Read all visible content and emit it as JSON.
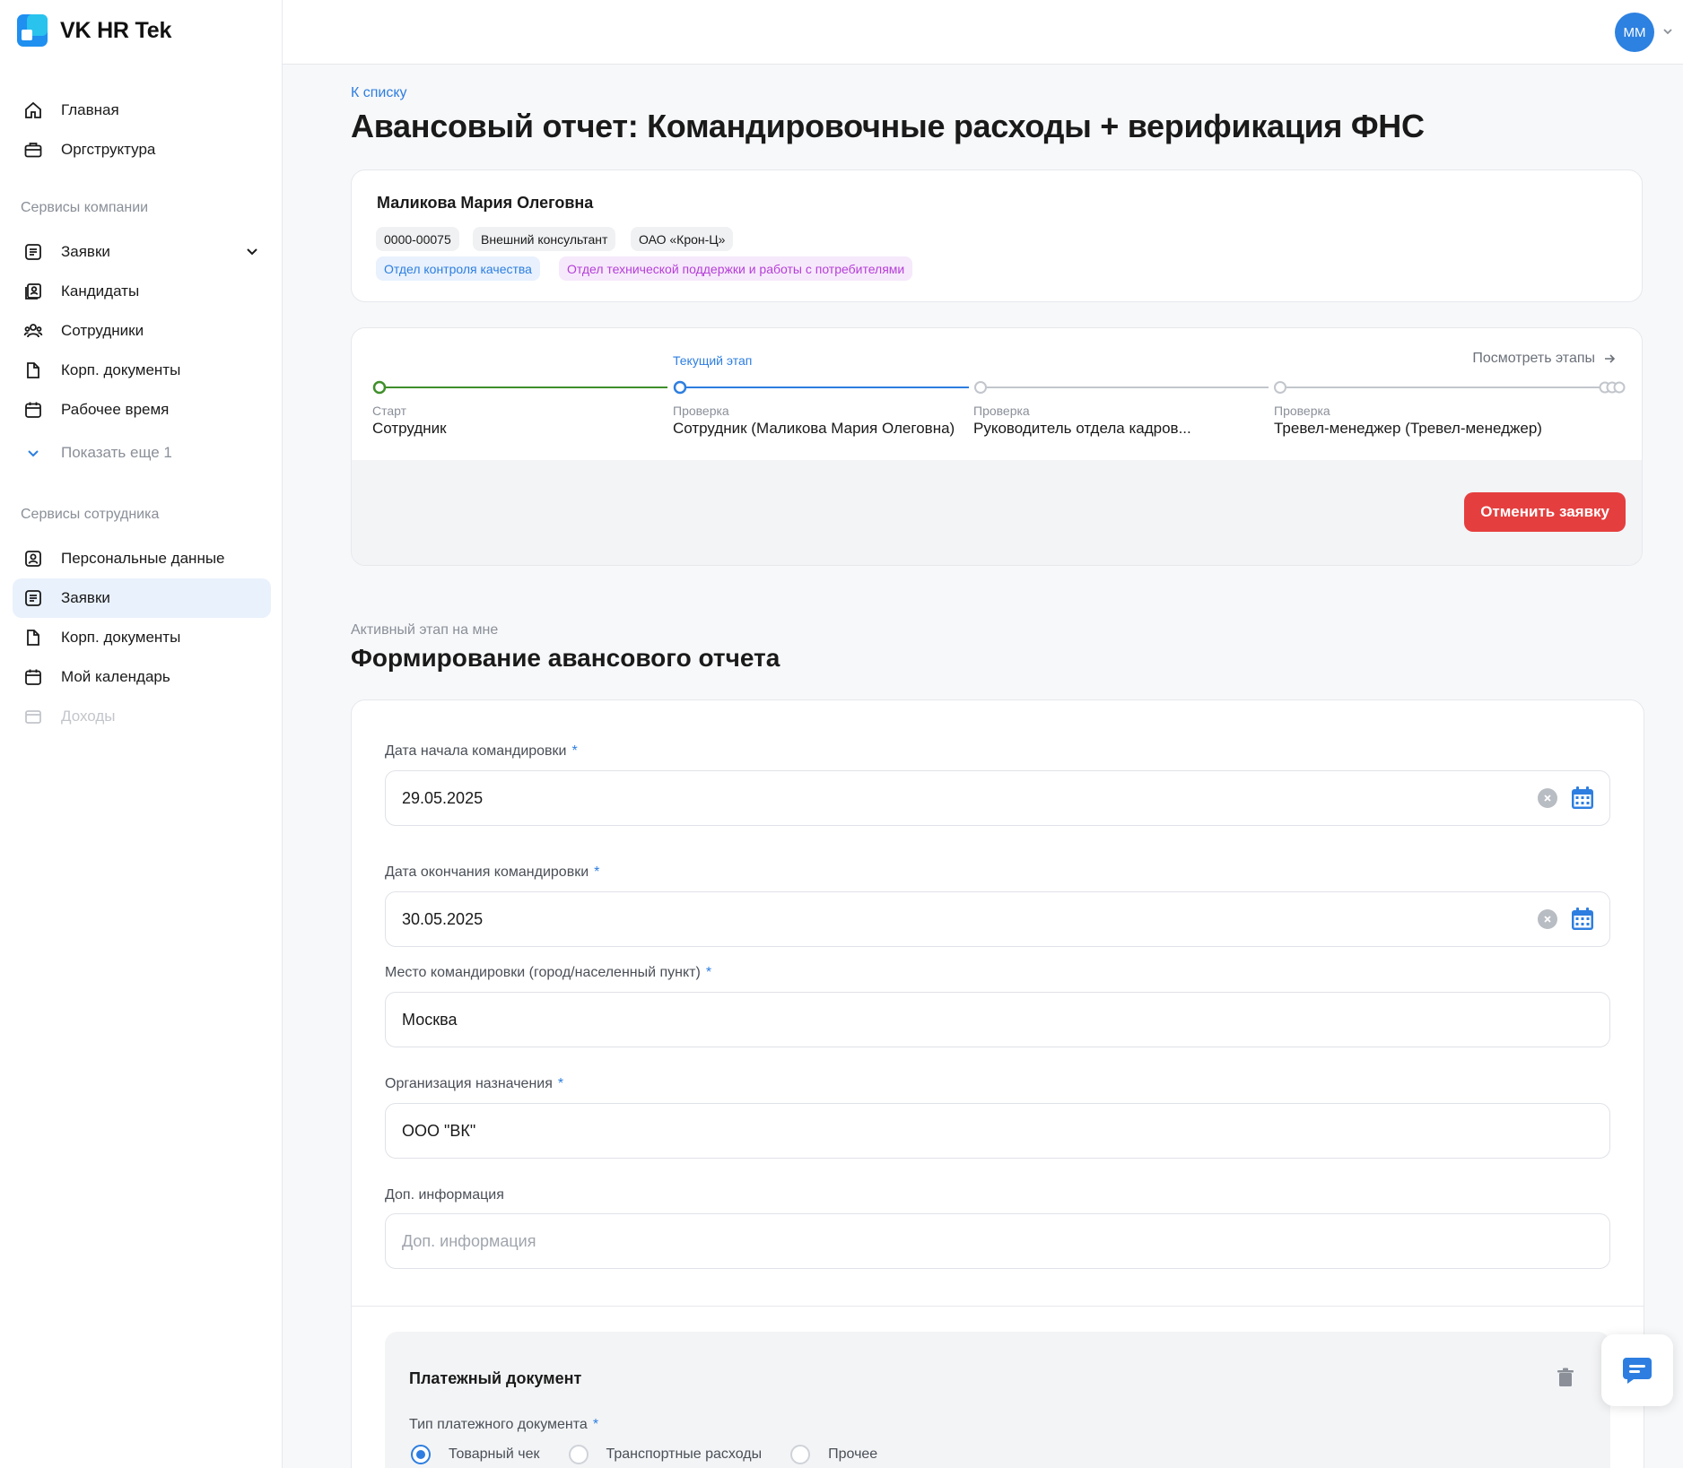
{
  "app": {
    "name": "VK HR Tek"
  },
  "sidebar": {
    "top_items": [
      {
        "label": "Главная",
        "icon": "home-icon"
      },
      {
        "label": "Оргструктура",
        "icon": "briefcase-icon"
      }
    ],
    "company_section_title": "Сервисы компании",
    "company_items": [
      {
        "label": "Заявки",
        "icon": "requests-icon"
      },
      {
        "label": "Кандидаты",
        "icon": "candidates-icon"
      },
      {
        "label": "Сотрудники",
        "icon": "employees-icon"
      },
      {
        "label": "Корп. документы",
        "icon": "document-icon"
      },
      {
        "label": "Рабочее время",
        "icon": "calendar-icon"
      }
    ],
    "show_more_label": "Показать еще 1",
    "employee_section_title": "Сервисы сотрудника",
    "employee_items": [
      {
        "label": "Персональные данные",
        "icon": "person-icon"
      },
      {
        "label": "Заявки",
        "icon": "requests-icon",
        "active": true
      },
      {
        "label": "Корп. документы",
        "icon": "document-icon"
      },
      {
        "label": "Мой календарь",
        "icon": "calendar-icon"
      },
      {
        "label": "Доходы",
        "icon": "income-icon"
      }
    ]
  },
  "header": {
    "avatar_initials": "ММ"
  },
  "page": {
    "back_link": "К списку",
    "title": "Авансовый отчет: Командировочные расходы + верификация ФНС"
  },
  "person": {
    "name": "Маликова Мария Олеговна",
    "tags": [
      "0000-00075",
      "Внешний консультант",
      "ОАО «Крон-Ц»"
    ],
    "departments": [
      "Отдел контроля качества",
      "Отдел технической поддержки и работы с потребителями"
    ]
  },
  "stages": {
    "current_label": "Текущий этап",
    "view_stages": "Посмотреть этапы",
    "items": [
      {
        "label": "Старт",
        "value": "Сотрудник"
      },
      {
        "label": "Проверка",
        "value": "Сотрудник (Маликова Мария Олеговна)"
      },
      {
        "label": "Проверка",
        "value": "Руководитель отдела кадров..."
      },
      {
        "label": "Проверка",
        "value": "Тревел-менеджер (Тревел-менеджер)"
      }
    ],
    "colors": {
      "done": "#3f8f2a",
      "current": "#2d7ee0",
      "pending": "#c2c6cc"
    },
    "cancel_button": "Отменить заявку"
  },
  "active_stage": {
    "label": "Активный этап на мне",
    "title": "Формирование авансового отчета"
  },
  "form": {
    "start_date": {
      "label": "Дата начала командировки",
      "value": "29.05.2025"
    },
    "end_date": {
      "label": "Дата окончания командировки",
      "value": "30.05.2025"
    },
    "place": {
      "label": "Место командировки (город/населенный пункт)",
      "value": "Москва"
    },
    "organization": {
      "label": "Организация назначения",
      "value": "ООО \"ВК\""
    },
    "extra": {
      "label": "Доп. информация",
      "placeholder": "Доп. информация"
    },
    "required_mark": "*"
  },
  "payment": {
    "title": "Платежный документ",
    "type_label": "Тип платежного документа",
    "options": [
      "Товарный чек",
      "Транспортные расходы",
      "Прочее"
    ],
    "selected": "Товарный чек"
  },
  "theme": {
    "accent": "#2d7ee0",
    "danger": "#e53e3e",
    "active_bg": "#e9f1fc"
  }
}
